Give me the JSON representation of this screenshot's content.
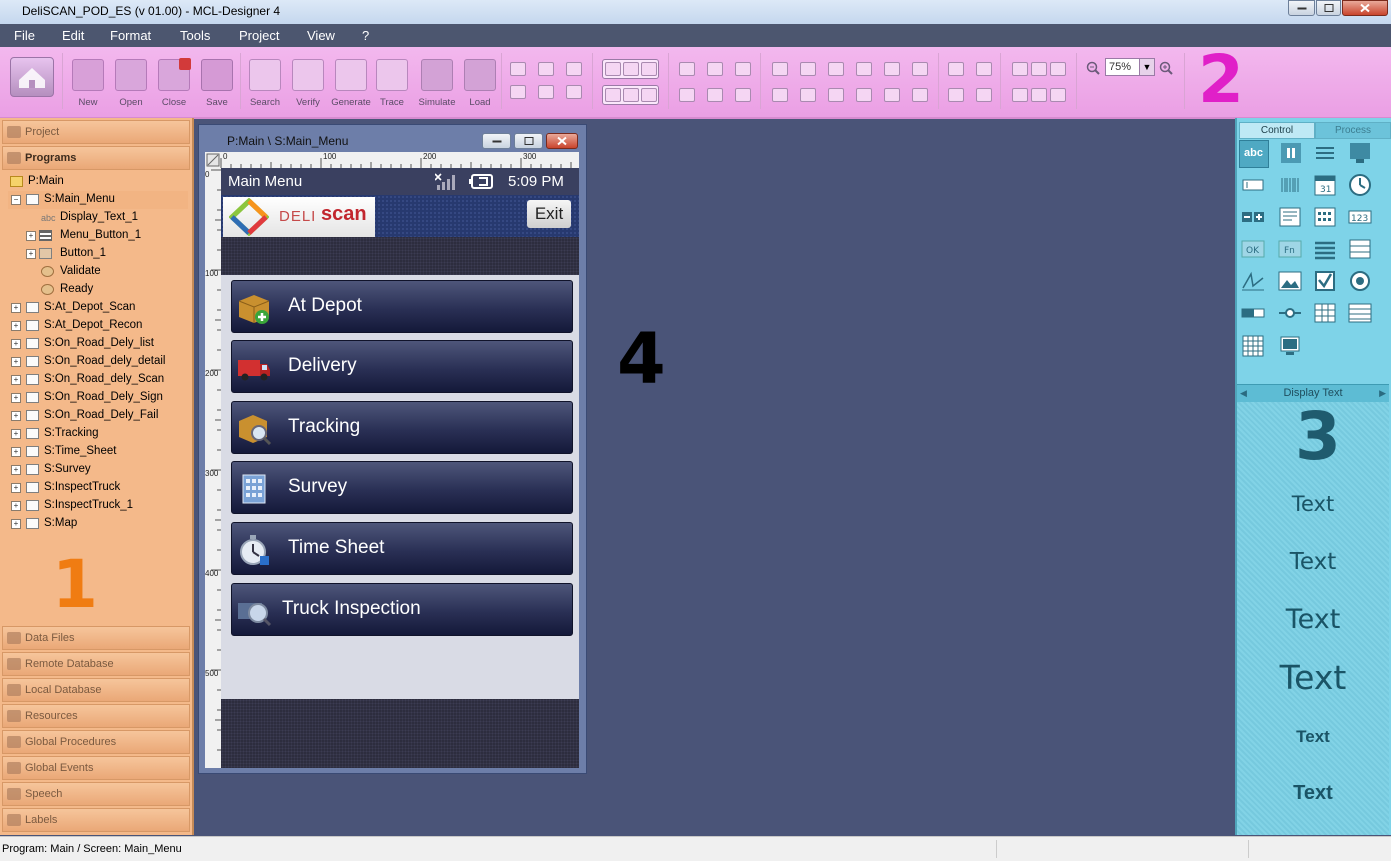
{
  "app": {
    "window_title": "DeliSCAN_POD_ES (v 01.00) - MCL-Designer 4"
  },
  "menu": [
    "File",
    "Edit",
    "Format",
    "Tools",
    "Project",
    "View",
    "?"
  ],
  "toolbar": {
    "buttons": [
      "New",
      "Open",
      "Close",
      "Save",
      "Search",
      "Verify",
      "Generate",
      "Trace",
      "Simulate",
      "Load"
    ],
    "zoom": "75%",
    "region_label": "2"
  },
  "left_panel": {
    "top_headers": [
      "Project",
      "Programs"
    ],
    "tree": [
      {
        "label": "P:Main",
        "level": 0
      },
      {
        "label": "S:Main_Menu",
        "level": 1,
        "expanded": true
      },
      {
        "label": "Display_Text_1",
        "level": 2
      },
      {
        "label": "Menu_Button_1",
        "level": 2
      },
      {
        "label": "Button_1",
        "level": 2
      },
      {
        "label": "Validate",
        "level": 2
      },
      {
        "label": "Ready",
        "level": 2
      },
      {
        "label": "S:At_Depot_Scan",
        "level": 1
      },
      {
        "label": "S:At_Depot_Recon",
        "level": 1
      },
      {
        "label": "S:On_Road_Dely_list",
        "level": 1
      },
      {
        "label": "S:On_Road_dely_detail",
        "level": 1
      },
      {
        "label": "S:On_Road_dely_Scan",
        "level": 1
      },
      {
        "label": "S:On_Road_Dely_Sign",
        "level": 1
      },
      {
        "label": "S:On_Road_Dely_Fail",
        "level": 1
      },
      {
        "label": "S:Tracking",
        "level": 1
      },
      {
        "label": "S:Time_Sheet",
        "level": 1
      },
      {
        "label": "S:Survey",
        "level": 1
      },
      {
        "label": "S:InspectTruck",
        "level": 1
      },
      {
        "label": "S:InspectTruck_1",
        "level": 1
      },
      {
        "label": "S:Map",
        "level": 1
      }
    ],
    "region_label": "1",
    "bottom_headers": [
      "Data Files",
      "Remote Database",
      "Local Database",
      "Resources",
      "Global Procedures",
      "Global Events",
      "Speech",
      "Labels"
    ]
  },
  "canvas": {
    "window_caption": "P:Main \\ S:Main_Menu",
    "ruler_top": [
      "0",
      "100",
      "200",
      "300"
    ],
    "ruler_left": [
      "0",
      "100",
      "200",
      "300",
      "400",
      "500"
    ],
    "region_label": "4",
    "device": {
      "title": "Main Menu",
      "time": "5:09 PM",
      "logo_left": "DELI",
      "logo_right": "scan",
      "exit_label": "Exit",
      "menu_buttons": [
        {
          "label": "At Depot",
          "icon": "box-add-icon"
        },
        {
          "label": "Delivery",
          "icon": "truck-icon"
        },
        {
          "label": "Tracking",
          "icon": "box-search-icon"
        },
        {
          "label": "Survey",
          "icon": "building-icon"
        },
        {
          "label": "Time Sheet",
          "icon": "stopwatch-icon"
        },
        {
          "label": "Truck Inspection",
          "icon": "inspection-icon"
        }
      ]
    }
  },
  "right_panel": {
    "tabs": [
      "Control",
      "Process"
    ],
    "section_title": "Display Text",
    "region_label": "3",
    "samples": [
      "Text",
      "Text",
      "Text",
      "Text",
      "Text",
      "Text"
    ]
  },
  "status_bar": {
    "text": "Program: Main / Screen: Main_Menu"
  },
  "colors": {
    "toolbar_bg": "#ea9fe4",
    "left_panel_bg": "#f4b98a",
    "right_panel_bg": "#7ed3e8",
    "workspace_bg": "#4a5478",
    "menubar_bg": "#4c566f",
    "region_label_2": "#e020c8",
    "region_label_1": "#f07c12",
    "region_label_3": "#1f5b6e",
    "region_label_4": "#000000"
  }
}
